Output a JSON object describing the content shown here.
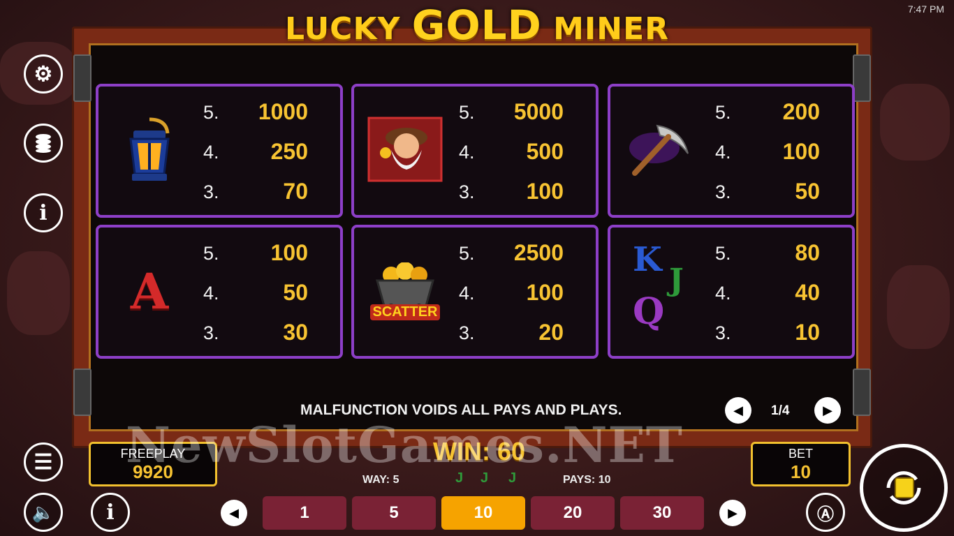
{
  "clock": "7:47 PM",
  "title": {
    "left": "LUCKY ",
    "mid": "GOLD",
    "right": " MINER"
  },
  "paytable": [
    {
      "symbol": "lantern-icon",
      "rows": [
        {
          "n": "5.",
          "v": "1000"
        },
        {
          "n": "4.",
          "v": "250"
        },
        {
          "n": "3.",
          "v": "70"
        }
      ]
    },
    {
      "symbol": "miner-icon",
      "rows": [
        {
          "n": "5.",
          "v": "5000"
        },
        {
          "n": "4.",
          "v": "500"
        },
        {
          "n": "3.",
          "v": "100"
        }
      ]
    },
    {
      "symbol": "pickaxe-icon",
      "rows": [
        {
          "n": "5.",
          "v": "200"
        },
        {
          "n": "4.",
          "v": "100"
        },
        {
          "n": "3.",
          "v": "50"
        }
      ]
    },
    {
      "symbol": "letter-a-icon",
      "letter": "A",
      "rows": [
        {
          "n": "5.",
          "v": "100"
        },
        {
          "n": "4.",
          "v": "50"
        },
        {
          "n": "3.",
          "v": "30"
        }
      ]
    },
    {
      "symbol": "scatter-icon",
      "label": "SCATTER",
      "rows": [
        {
          "n": "5.",
          "v": "2500"
        },
        {
          "n": "4.",
          "v": "100"
        },
        {
          "n": "3.",
          "v": "20"
        }
      ]
    },
    {
      "symbol": "kqj-icon",
      "letters": [
        "K",
        "J",
        "Q"
      ],
      "rows": [
        {
          "n": "5.",
          "v": "80"
        },
        {
          "n": "4.",
          "v": "40"
        },
        {
          "n": "3.",
          "v": "10"
        }
      ]
    }
  ],
  "footer_note": "MALFUNCTION VOIDS ALL PAYS AND PLAYS.",
  "page": "1/4",
  "freeplay": {
    "label": "FREEPLAY",
    "value": "9920"
  },
  "bet": {
    "label": "BET",
    "value": "10"
  },
  "win": "WIN: 60",
  "way": "WAY: 5",
  "pays": "PAYS: 10",
  "way_symbols": [
    "J",
    "J",
    "J"
  ],
  "bet_options": [
    "1",
    "5",
    "10",
    "20",
    "30"
  ],
  "active_bet": "10",
  "watermark": "NewSlotGames.NET",
  "colors": {
    "accent": "#f7c332",
    "panel_border": "#8d3fc7",
    "chip": "#7a2235",
    "chip_active": "#f6a300"
  }
}
